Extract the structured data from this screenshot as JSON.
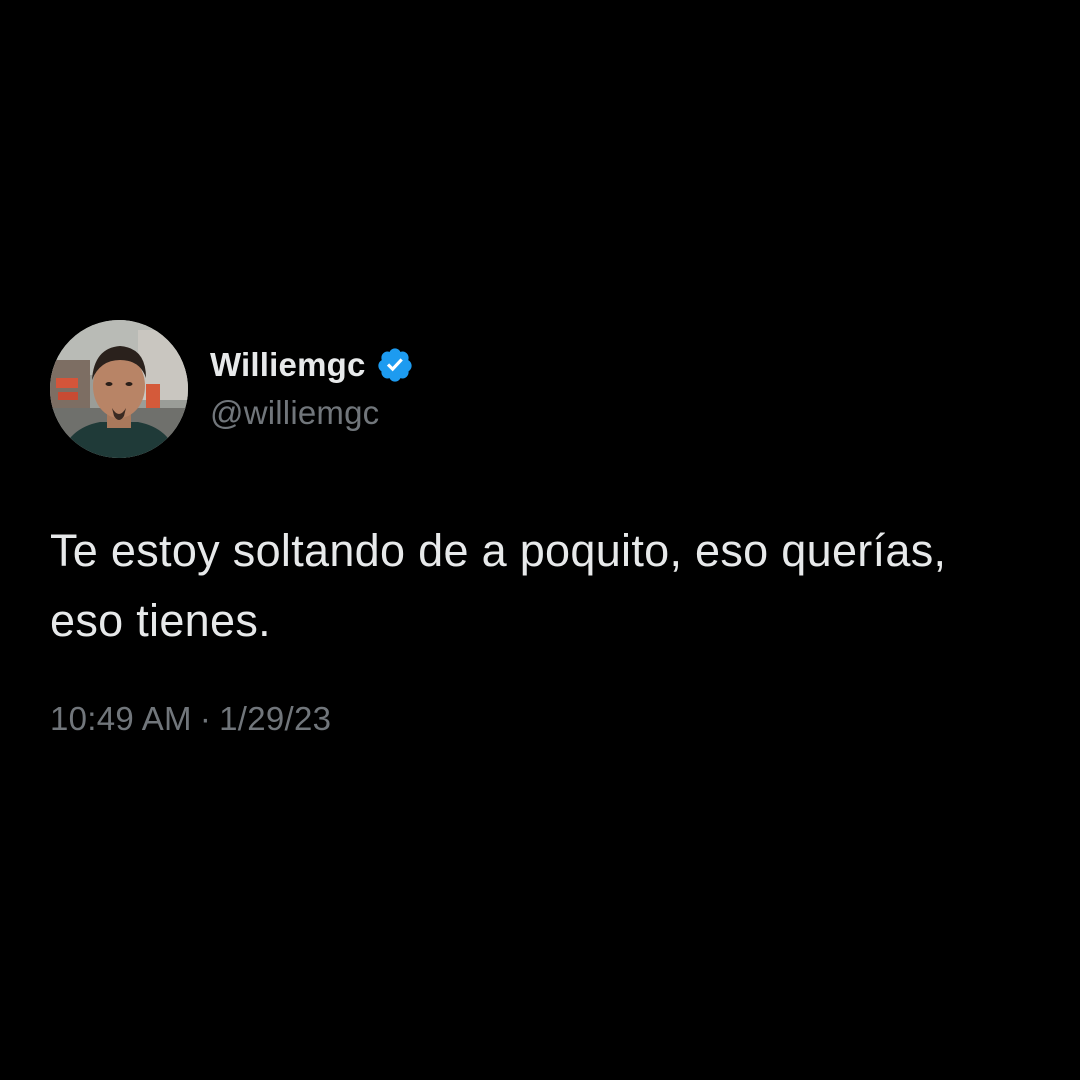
{
  "tweet": {
    "author": {
      "display_name": "Williemgc",
      "handle": "@williemgc",
      "verified": true,
      "verified_color": "#1d9bf0"
    },
    "text": "Te estoy soltando de a poquito, eso querías, eso tienes.",
    "time": "10:49 AM",
    "separator": "·",
    "date": "1/29/23"
  },
  "colors": {
    "background": "#000000",
    "primary_text": "#e7e9ea",
    "secondary_text": "#71767b"
  }
}
